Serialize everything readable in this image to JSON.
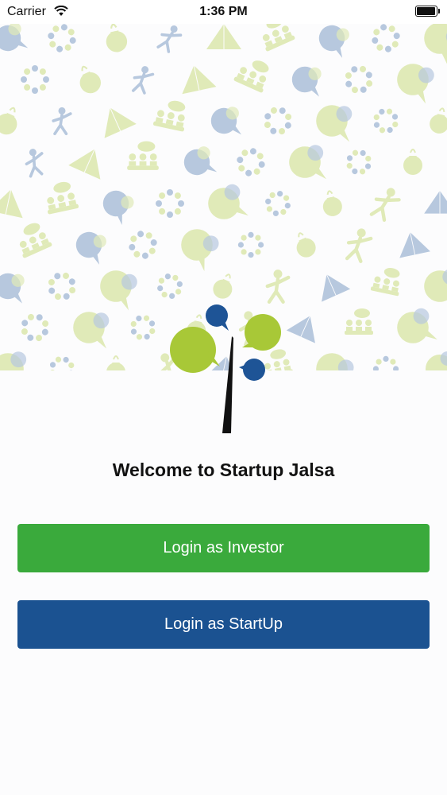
{
  "status_bar": {
    "carrier": "Carrier",
    "time": "1:36 PM"
  },
  "welcome": {
    "title": "Welcome to Startup Jalsa"
  },
  "buttons": {
    "investor_label": "Login as Investor",
    "startup_label": "Login as StartUp"
  },
  "colors": {
    "investor_button": "#3aaa3c",
    "startup_button": "#1b5291",
    "logo_green": "#a8c837",
    "logo_blue": "#1e5496",
    "pattern_green": "#e0eab8",
    "pattern_blue": "#b7c8de"
  },
  "icons": {
    "background_pattern": [
      "handshake-icon",
      "people-circle-icon",
      "speech-bubble-icon",
      "money-bag-icon",
      "tent-icon",
      "team-meeting-icon"
    ]
  }
}
